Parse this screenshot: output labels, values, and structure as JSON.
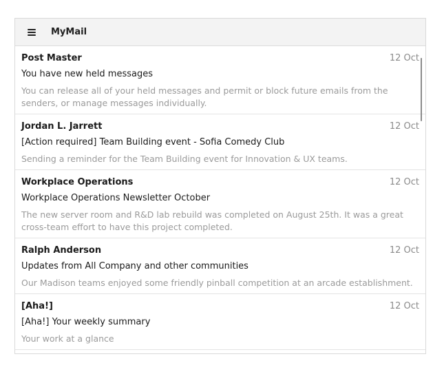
{
  "header": {
    "title": "MyMail"
  },
  "messages": [
    {
      "sender": "Post Master",
      "date": "12 Oct",
      "subject": "You have new held messages",
      "preview": "You can release all of your held messages and permit or block future emails from the senders, or manage messages individually."
    },
    {
      "sender": "Jordan L. Jarrett",
      "date": "12 Oct",
      "subject": "[Action required] Team Building event - Sofia Comedy Club",
      "preview": "Sending a reminder for the Team Building event for Innovation & UX teams."
    },
    {
      "sender": "Workplace Operations",
      "date": "12 Oct",
      "subject": "Workplace Operations Newsletter October",
      "preview": "The new server room and R&D lab rebuild was completed on August 25th. It was a great cross-team effort to have this project completed."
    },
    {
      "sender": "Ralph Anderson",
      "date": "12 Oct",
      "subject": "Updates from All Company and other communities",
      "preview": "Our Madison teams enjoyed some friendly pinball competition at an arcade establishment."
    },
    {
      "sender": "[Aha!]",
      "date": "12 Oct",
      "subject": "[Aha!] Your weekly summary",
      "preview": "Your work at a glance"
    }
  ],
  "icons": {
    "menu": "hamburger-menu-icon"
  }
}
